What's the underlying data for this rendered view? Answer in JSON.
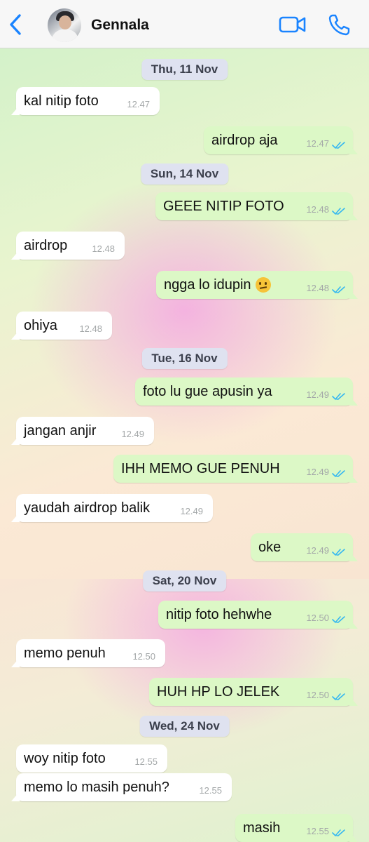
{
  "header": {
    "contact_name": "Gennala"
  },
  "dates": [
    "Thu, 11 Nov",
    "Sun, 14 Nov",
    "Tue, 16 Nov",
    "Sat, 20 Nov",
    "Wed, 24 Nov"
  ],
  "messages": [
    {
      "dir": "in",
      "text": "kal nitip foto",
      "time": "12.47"
    },
    {
      "dir": "out",
      "text": "airdrop aja",
      "time": "12.47"
    },
    {
      "dir": "out",
      "text": "GEEE NITIP FOTO",
      "time": "12.48"
    },
    {
      "dir": "in",
      "text": "airdrop",
      "time": "12.48"
    },
    {
      "dir": "out",
      "text": "ngga lo idupin",
      "time": "12.48",
      "emoji": "raised-eyebrow-emoji"
    },
    {
      "dir": "in",
      "text": "ohiya",
      "time": "12.48"
    },
    {
      "dir": "out",
      "text": "foto lu gue apusin ya",
      "time": "12.49"
    },
    {
      "dir": "in",
      "text": "jangan anjir",
      "time": "12.49"
    },
    {
      "dir": "out",
      "text": "IHH MEMO GUE PENUH",
      "time": "12.49"
    },
    {
      "dir": "in",
      "text": "yaudah airdrop balik",
      "time": "12.49"
    },
    {
      "dir": "out",
      "text": "oke",
      "time": "12.49"
    },
    {
      "dir": "out",
      "text": "nitip foto hehwhe",
      "time": "12.50"
    },
    {
      "dir": "in",
      "text": "memo penuh",
      "time": "12.50"
    },
    {
      "dir": "out",
      "text": "HUH HP LO JELEK",
      "time": "12.50"
    },
    {
      "dir": "in",
      "text": "woy nitip foto",
      "time": "12.55"
    },
    {
      "dir": "in",
      "text": "memo lo masih penuh?",
      "time": "12.55"
    },
    {
      "dir": "out",
      "text": "masih",
      "time": "12.55"
    }
  ],
  "colors": {
    "accent": "#1a84ff",
    "outgoing_bubble": "#dcf8c6",
    "incoming_bubble": "#ffffff",
    "read_ticks": "#34b7f1"
  },
  "icons": [
    "chevron-left-icon",
    "video-call-icon",
    "phone-icon",
    "double-check-icon"
  ]
}
